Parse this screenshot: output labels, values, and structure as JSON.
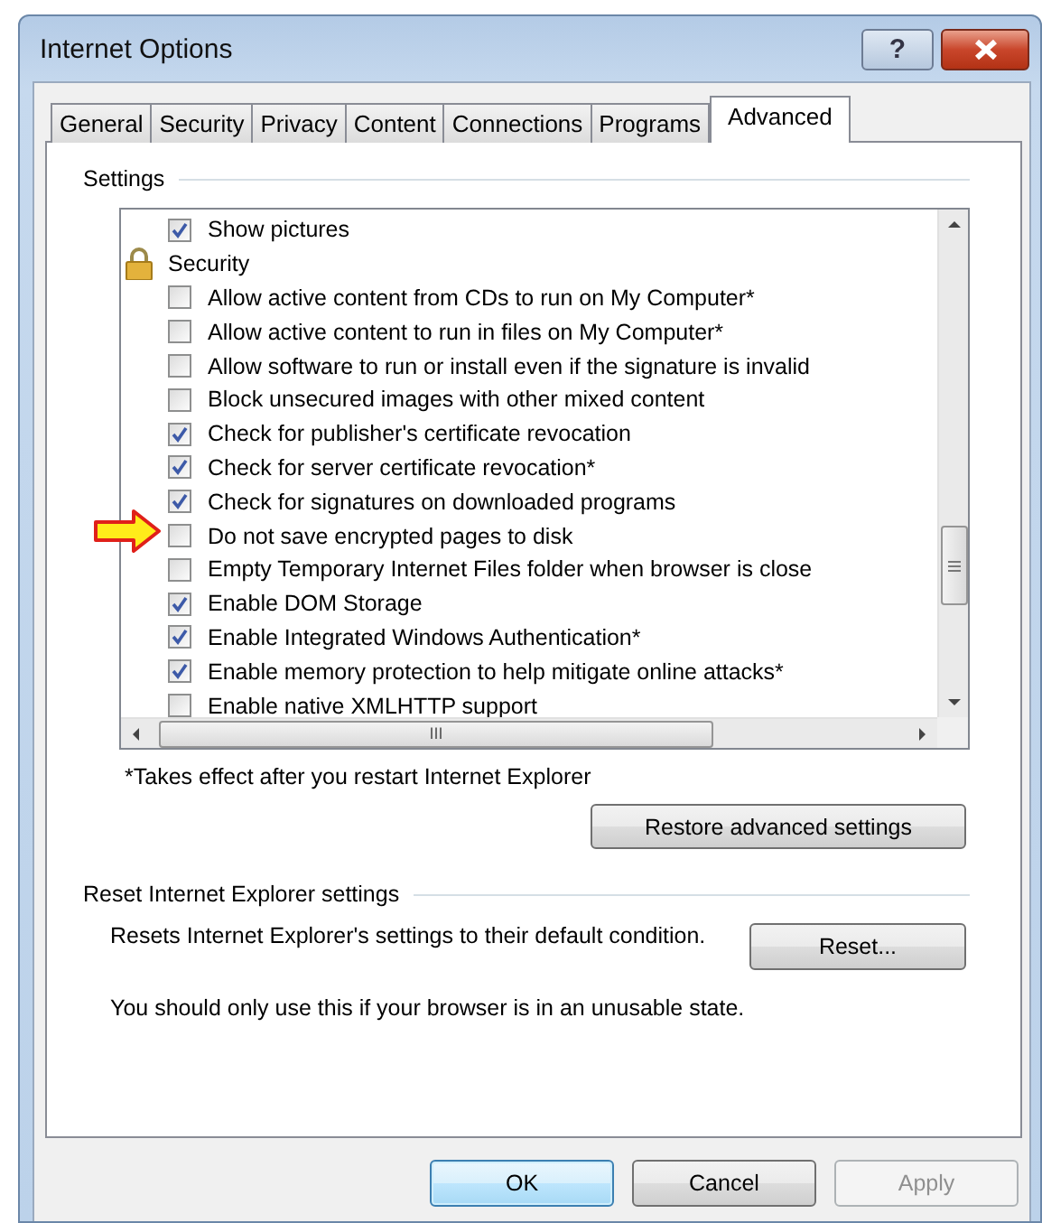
{
  "window": {
    "title": "Internet Options",
    "help_label": "?"
  },
  "tabs": [
    {
      "label": "General",
      "selected": false
    },
    {
      "label": "Security",
      "selected": false
    },
    {
      "label": "Privacy",
      "selected": false
    },
    {
      "label": "Content",
      "selected": false
    },
    {
      "label": "Connections",
      "selected": false
    },
    {
      "label": "Programs",
      "selected": false
    },
    {
      "label": "Advanced",
      "selected": true
    }
  ],
  "settings": {
    "heading": "Settings",
    "items": [
      {
        "kind": "checkbox",
        "label": "Show pictures",
        "checked": true,
        "pointed": false
      },
      {
        "kind": "category",
        "label": "Security"
      },
      {
        "kind": "checkbox",
        "label": "Allow active content from CDs to run on My Computer*",
        "checked": false,
        "pointed": false
      },
      {
        "kind": "checkbox",
        "label": "Allow active content to run in files on My Computer*",
        "checked": false,
        "pointed": false
      },
      {
        "kind": "checkbox",
        "label": "Allow software to run or install even if the signature is invalid",
        "checked": false,
        "pointed": false
      },
      {
        "kind": "checkbox",
        "label": "Block unsecured images with other mixed content",
        "checked": false,
        "pointed": false
      },
      {
        "kind": "checkbox",
        "label": "Check for publisher's certificate revocation",
        "checked": true,
        "pointed": false
      },
      {
        "kind": "checkbox",
        "label": "Check for server certificate revocation*",
        "checked": true,
        "pointed": false
      },
      {
        "kind": "checkbox",
        "label": "Check for signatures on downloaded programs",
        "checked": true,
        "pointed": false
      },
      {
        "kind": "checkbox",
        "label": "Do not save encrypted pages to disk",
        "checked": false,
        "pointed": true
      },
      {
        "kind": "checkbox",
        "label": "Empty Temporary Internet Files folder when browser is close",
        "checked": false,
        "pointed": false
      },
      {
        "kind": "checkbox",
        "label": "Enable DOM Storage",
        "checked": true,
        "pointed": false
      },
      {
        "kind": "checkbox",
        "label": "Enable Integrated Windows Authentication*",
        "checked": true,
        "pointed": false
      },
      {
        "kind": "checkbox",
        "label": "Enable memory protection to help mitigate online attacks*",
        "checked": true,
        "pointed": false
      },
      {
        "kind": "checkbox",
        "label": "Enable native XMLHTTP support",
        "checked": false,
        "pointed": false
      }
    ],
    "hscroll_grip": "III",
    "note": "*Takes effect after you restart Internet Explorer",
    "restore_button": "Restore advanced settings"
  },
  "reset": {
    "heading": "Reset Internet Explorer settings",
    "description": "Resets Internet Explorer's settings to their default condition.",
    "button": "Reset...",
    "warning": "You should only use this if your browser is in an unusable state."
  },
  "buttons": [
    {
      "label": "OK",
      "default": true,
      "disabled": false
    },
    {
      "label": "Cancel",
      "default": false,
      "disabled": false
    },
    {
      "label": "Apply",
      "default": false,
      "disabled": true
    }
  ]
}
